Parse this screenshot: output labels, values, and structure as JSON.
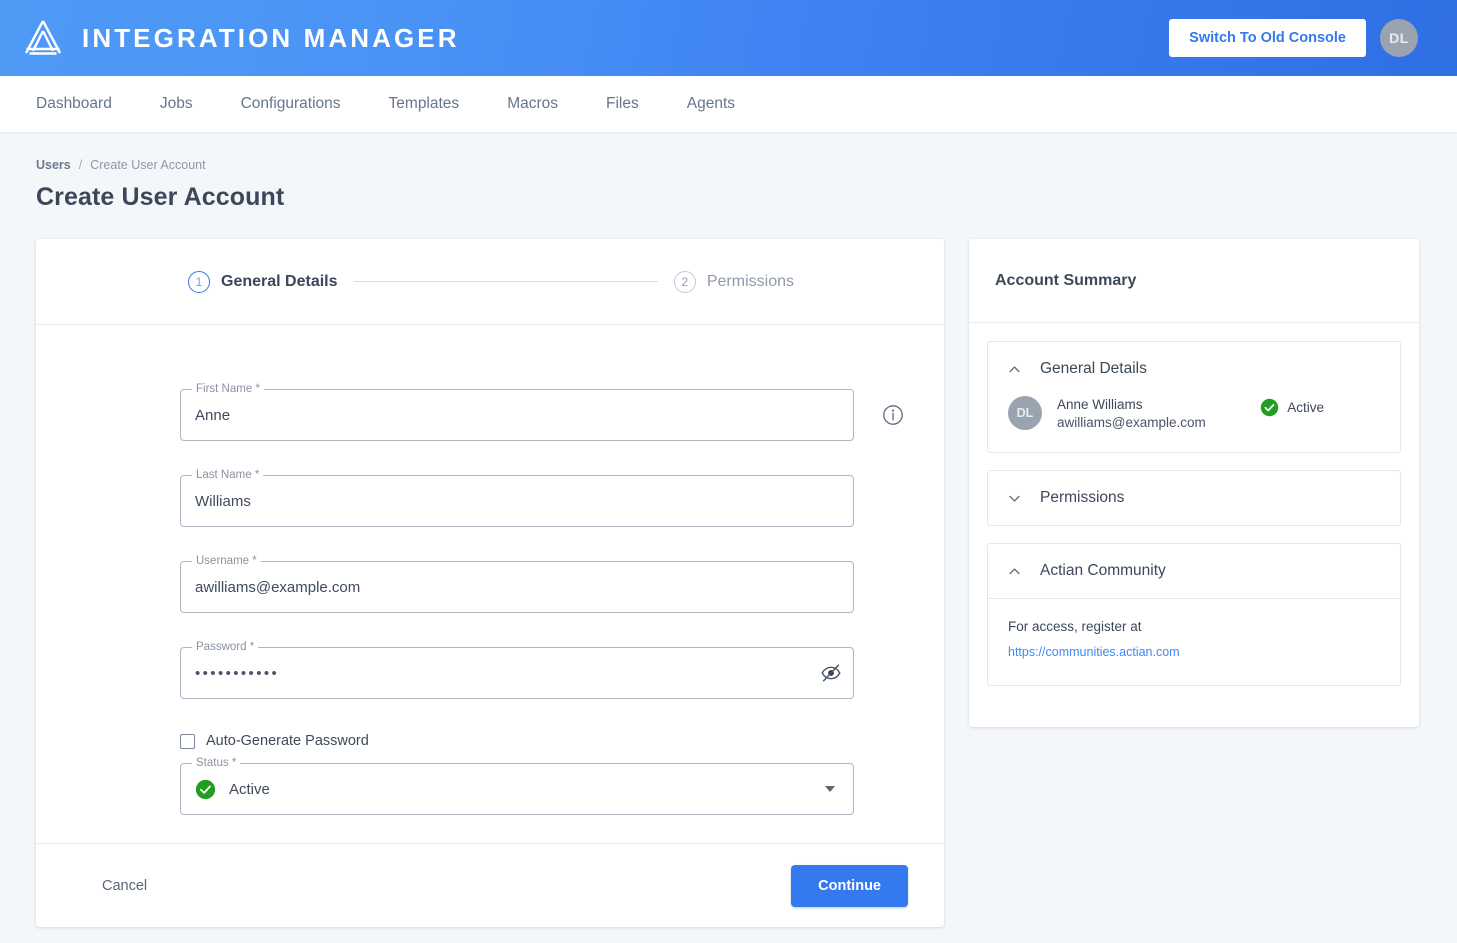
{
  "header": {
    "brand_title": "INTEGRATION MANAGER",
    "logo_icon": "mountain-logo-icon",
    "switch_button": "Switch To Old Console",
    "avatar_initials": "DL",
    "avatar_caret_icon": "chevron-down-icon"
  },
  "nav": {
    "items": [
      {
        "label": "Dashboard"
      },
      {
        "label": "Jobs"
      },
      {
        "label": "Configurations"
      },
      {
        "label": "Templates"
      },
      {
        "label": "Macros"
      },
      {
        "label": "Files"
      },
      {
        "label": "Agents"
      }
    ]
  },
  "breadcrumb": {
    "parent": "Users",
    "separator": "/",
    "current": "Create User Account"
  },
  "page": {
    "title": "Create User Account"
  },
  "stepper": {
    "steps": [
      {
        "number": "1",
        "label": "General Details",
        "state": "active"
      },
      {
        "number": "2",
        "label": "Permissions",
        "state": "inactive"
      }
    ]
  },
  "form": {
    "first_name": {
      "label": "First Name",
      "required_mark": "*",
      "value": "Anne",
      "info_icon": "info-circle-icon"
    },
    "last_name": {
      "label": "Last Name",
      "required_mark": "*",
      "value": "Williams"
    },
    "username": {
      "label": "Username",
      "required_mark": "*",
      "value": "awilliams@example.com"
    },
    "password": {
      "label": "Password",
      "required_mark": "*",
      "masked_value": "•••••••••••",
      "toggle_icon": "eye-off-icon"
    },
    "auto_generate": {
      "label": "Auto-Generate Password",
      "checked": false
    },
    "status": {
      "label": "Status",
      "required_mark": "*",
      "value": "Active",
      "status_icon": "check-circle-icon",
      "caret_icon": "caret-down-icon"
    }
  },
  "footer": {
    "cancel_label": "Cancel",
    "continue_label": "Continue"
  },
  "summary": {
    "title": "Account Summary",
    "sections": [
      {
        "title": "General Details",
        "chevron_icon": "chevron-up-icon",
        "expanded": true,
        "avatar_initials": "DL",
        "name": "Anne Williams",
        "email": "awilliams@example.com",
        "status_label": "Active",
        "status_icon": "check-circle-icon"
      },
      {
        "title": "Permissions",
        "chevron_icon": "chevron-down-icon",
        "expanded": false
      },
      {
        "title": "Actian Community",
        "chevron_icon": "chevron-up-icon",
        "expanded": true,
        "body_text": "For access, register at",
        "link_text": "https://communities.actian.com"
      }
    ]
  },
  "colors": {
    "header_gradient_start": "#4f9af5",
    "header_gradient_end": "#2f6fe4",
    "primary": "#3479f0",
    "success_green": "#1f9e20",
    "page_background": "#f4f7fa",
    "avatar_gray": "#9aa3b0",
    "link_blue": "#3d8bf2"
  }
}
